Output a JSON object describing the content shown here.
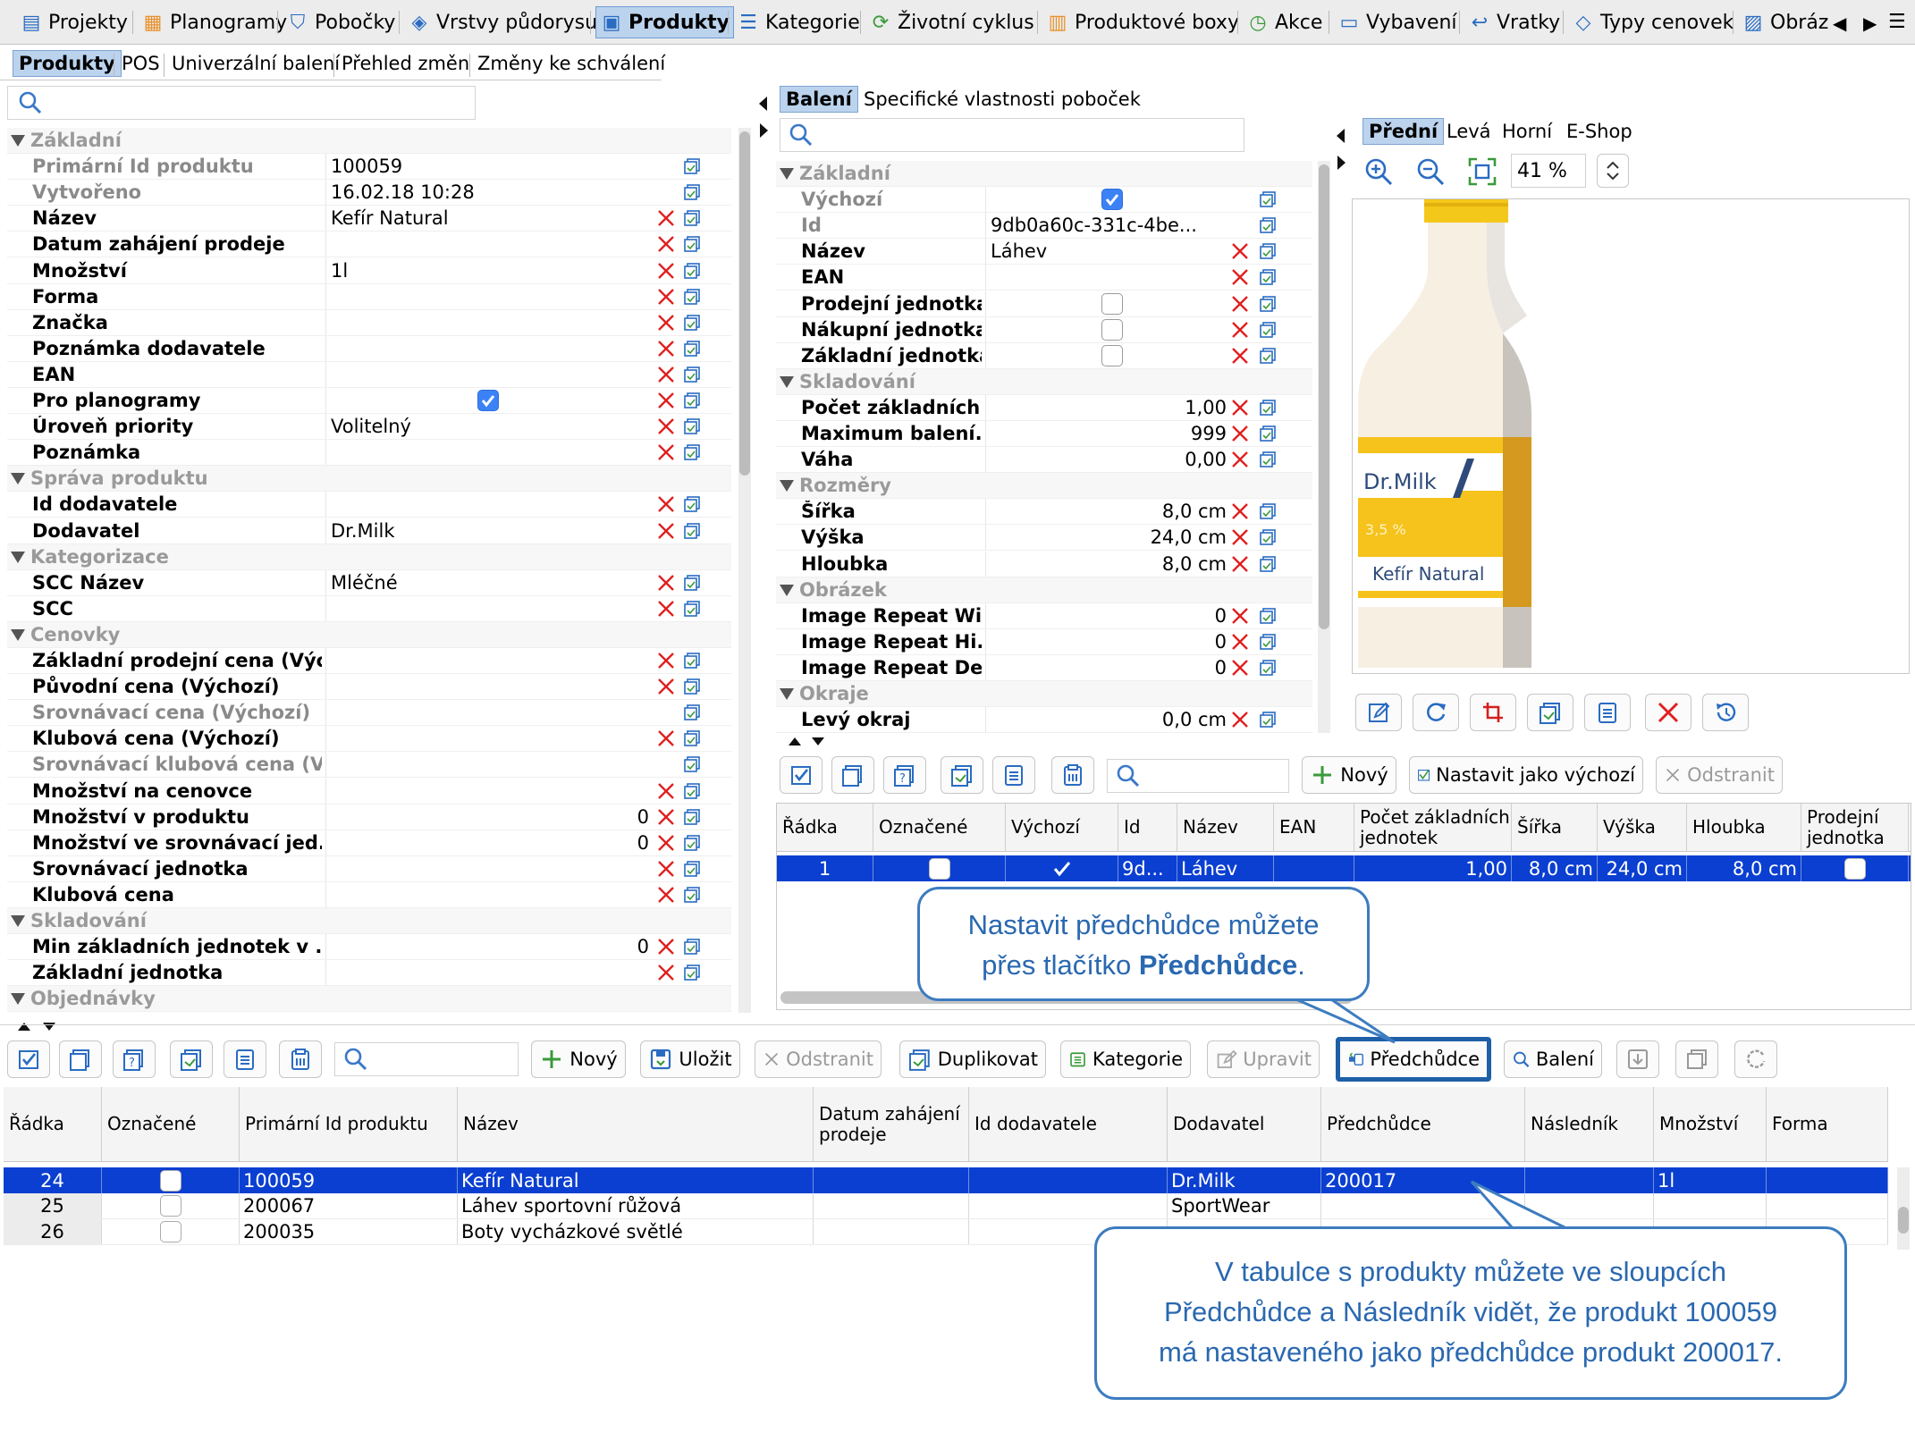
{
  "main_tabs": [
    {
      "label": "Projekty",
      "icon": "projects-icon"
    },
    {
      "label": "Planogramy",
      "icon": "planogram-icon"
    },
    {
      "label": "Pobočky",
      "icon": "store-icon"
    },
    {
      "label": "Vrstvy půdorysu",
      "icon": "layers-icon"
    },
    {
      "label": "Produkty",
      "icon": "products-icon",
      "selected": true
    },
    {
      "label": "Kategorie",
      "icon": "category-icon"
    },
    {
      "label": "Životní cyklus",
      "icon": "lifecycle-icon"
    },
    {
      "label": "Produktové boxy",
      "icon": "box-icon"
    },
    {
      "label": "Akce",
      "icon": "clock-icon"
    },
    {
      "label": "Vybavení",
      "icon": "equipment-icon"
    },
    {
      "label": "Vratky",
      "icon": "return-icon"
    },
    {
      "label": "Typy cenovek",
      "icon": "price-tag-icon"
    },
    {
      "label": "Obráz",
      "icon": "image-icon"
    }
  ],
  "sub_tabs": [
    "Produkty",
    "POS",
    "Univerzální balení",
    "Přehled změn",
    "Změny ke schválení"
  ],
  "left_props": [
    {
      "t": "sec",
      "label": "Základní"
    },
    {
      "label": "Primární Id produktu",
      "value": "100059",
      "dim": true,
      "x": false
    },
    {
      "label": "Vytvořeno",
      "value": "16.02.18 10:28",
      "dim": true,
      "x": false
    },
    {
      "label": "Název",
      "value": "Kefír Natural"
    },
    {
      "label": "Datum zahájení prodeje",
      "value": ""
    },
    {
      "label": "Množství",
      "value": "1l"
    },
    {
      "label": "Forma",
      "value": ""
    },
    {
      "label": "Značka",
      "value": ""
    },
    {
      "label": "Poznámka dodavatele",
      "value": ""
    },
    {
      "label": "EAN",
      "value": ""
    },
    {
      "label": "Pro planogramy",
      "check": true
    },
    {
      "label": "Úroveň priority",
      "value": "Volitelný"
    },
    {
      "label": "Poznámka",
      "value": ""
    },
    {
      "t": "sec",
      "label": "Správa produktu"
    },
    {
      "label": "Id dodavatele",
      "value": ""
    },
    {
      "label": "Dodavatel",
      "value": "Dr.Milk"
    },
    {
      "t": "sec",
      "label": "Kategorizace"
    },
    {
      "label": "SCC Název",
      "value": "Mléčné"
    },
    {
      "label": "SCC",
      "value": ""
    },
    {
      "t": "sec",
      "label": "Cenovky"
    },
    {
      "label": "Základní prodejní cena (Výc...",
      "value": ""
    },
    {
      "label": "Původní cena (Výchozí)",
      "value": ""
    },
    {
      "label": "Srovnávací cena (Výchozí)",
      "value": "",
      "dim": true,
      "x": false
    },
    {
      "label": "Klubová cena (Výchozí)",
      "value": ""
    },
    {
      "label": "Srovnávací klubová cena (V...",
      "value": "",
      "dim": true,
      "x": false
    },
    {
      "label": "Množství na cenovce",
      "value": ""
    },
    {
      "label": "Množství v produktu",
      "value": "0",
      "right": true
    },
    {
      "label": "Množství ve srovnávací jed...",
      "value": "0",
      "right": true
    },
    {
      "label": "Srovnávací jednotka",
      "value": ""
    },
    {
      "label": "Klubová cena",
      "value": ""
    },
    {
      "t": "sec",
      "label": "Skladování"
    },
    {
      "label": "Min základních jednotek v ...",
      "value": "0",
      "right": true
    },
    {
      "label": "Základní jednotka",
      "value": ""
    },
    {
      "t": "sec",
      "label": "Objednávky"
    }
  ],
  "mid_tabs": [
    "Balení",
    "Specifické vlastnosti poboček"
  ],
  "mid_props": [
    {
      "t": "sec",
      "label": "Základní"
    },
    {
      "label": "Výchozí",
      "check": true,
      "dim": true,
      "x": false
    },
    {
      "label": "Id",
      "value": "9db0a60c-331c-4be...",
      "dim": true,
      "x": false
    },
    {
      "label": "Název",
      "value": "Láhev"
    },
    {
      "label": "EAN",
      "value": ""
    },
    {
      "label": "Prodejní jednotka",
      "check": false
    },
    {
      "label": "Nákupní jednotka",
      "check": false
    },
    {
      "label": "Základní jednotka",
      "check": false
    },
    {
      "t": "sec",
      "label": "Skladování"
    },
    {
      "label": "Počet základních...",
      "value": "1,00",
      "right": true
    },
    {
      "label": "Maximum balení...",
      "value": "999",
      "right": true
    },
    {
      "label": "Váha",
      "value": "0,00",
      "right": true
    },
    {
      "t": "sec",
      "label": "Rozměry"
    },
    {
      "label": "Šířka",
      "value": "8,0 cm",
      "right": true
    },
    {
      "label": "Výška",
      "value": "24,0 cm",
      "right": true
    },
    {
      "label": "Hloubka",
      "value": "8,0 cm",
      "right": true
    },
    {
      "t": "sec",
      "label": "Obrázek"
    },
    {
      "label": "Image Repeat Wi...",
      "value": "0",
      "right": true
    },
    {
      "label": "Image Repeat Hi...",
      "value": "0",
      "right": true
    },
    {
      "label": "Image Repeat De...",
      "value": "0",
      "right": true
    },
    {
      "t": "sec",
      "label": "Okraje"
    },
    {
      "label": "Levý okraj",
      "value": "0,0 cm",
      "right": true
    }
  ],
  "view_tabs": [
    "Přední",
    "Levá",
    "Horní",
    "E-Shop"
  ],
  "zoom": "41 %",
  "bottle": {
    "brand": "Dr.Milk",
    "fat": "3,5 %",
    "product": "Kefír Natural"
  },
  "mid_toolbar": {
    "new": "Nový",
    "set_default": "Nastavit jako výchozí",
    "remove": "Odstranit"
  },
  "pack_cols": [
    "Řádka",
    "Označené",
    "Výchozí",
    "Id",
    "Název",
    "EAN",
    "Počet základních jednotek",
    "Šířka",
    "Výška",
    "Hloubka",
    "Prodejní jednotka"
  ],
  "pack_row": {
    "row": "1",
    "id": "9d...",
    "name": "Láhev",
    "ean": "",
    "count": "1,00",
    "w": "8,0 cm",
    "h": "24,0 cm",
    "d": "8,0 cm"
  },
  "bottom_toolbar": {
    "new": "Nový",
    "save": "Uložit",
    "remove": "Odstranit",
    "duplicate": "Duplikovat",
    "category": "Kategorie",
    "edit": "Upravit",
    "predecessor": "Předchůdce",
    "packaging": "Balení"
  },
  "prod_cols": [
    "Řádka",
    "Označené",
    "Primární Id produktu",
    "Název",
    "Datum zahájení prodeje",
    "Id dodavatele",
    "Dodavatel",
    "Předchůdce",
    "Následník",
    "Množství",
    "Forma"
  ],
  "prod_rows": [
    {
      "row": "24",
      "id": "100059",
      "name": "Kefír Natural",
      "supplier": "Dr.Milk",
      "pred": "200017",
      "succ": "",
      "qty": "1l",
      "sel": true
    },
    {
      "row": "25",
      "id": "200067",
      "name": "Láhev sportovní růžová",
      "supplier": "SportWear",
      "pred": "",
      "succ": "",
      "qty": ""
    },
    {
      "row": "26",
      "id": "200035",
      "name": "Boty vycházkové světlé",
      "supplier": "",
      "pred": "",
      "succ": "",
      "qty": ""
    }
  ],
  "callout1": {
    "line1": "Nastavit předchůdce můžete",
    "line2_pre": "přes tlačítko ",
    "line2_bold": "Předchůdce",
    "line2_post": "."
  },
  "callout2": {
    "line1": "V tabulce s produkty můžete ve sloupcích",
    "line2": "Předchůdce a Následník vidět, že produkt 100059",
    "line3": "má nastaveného jako předchůdce produkt 200017."
  },
  "colors": {
    "selection": "#0b3fd1",
    "tab_selected": "#bcd3ee",
    "callout_border": "#3d7cc0",
    "callout_text": "#2a68b0",
    "delete": "#e02020"
  }
}
